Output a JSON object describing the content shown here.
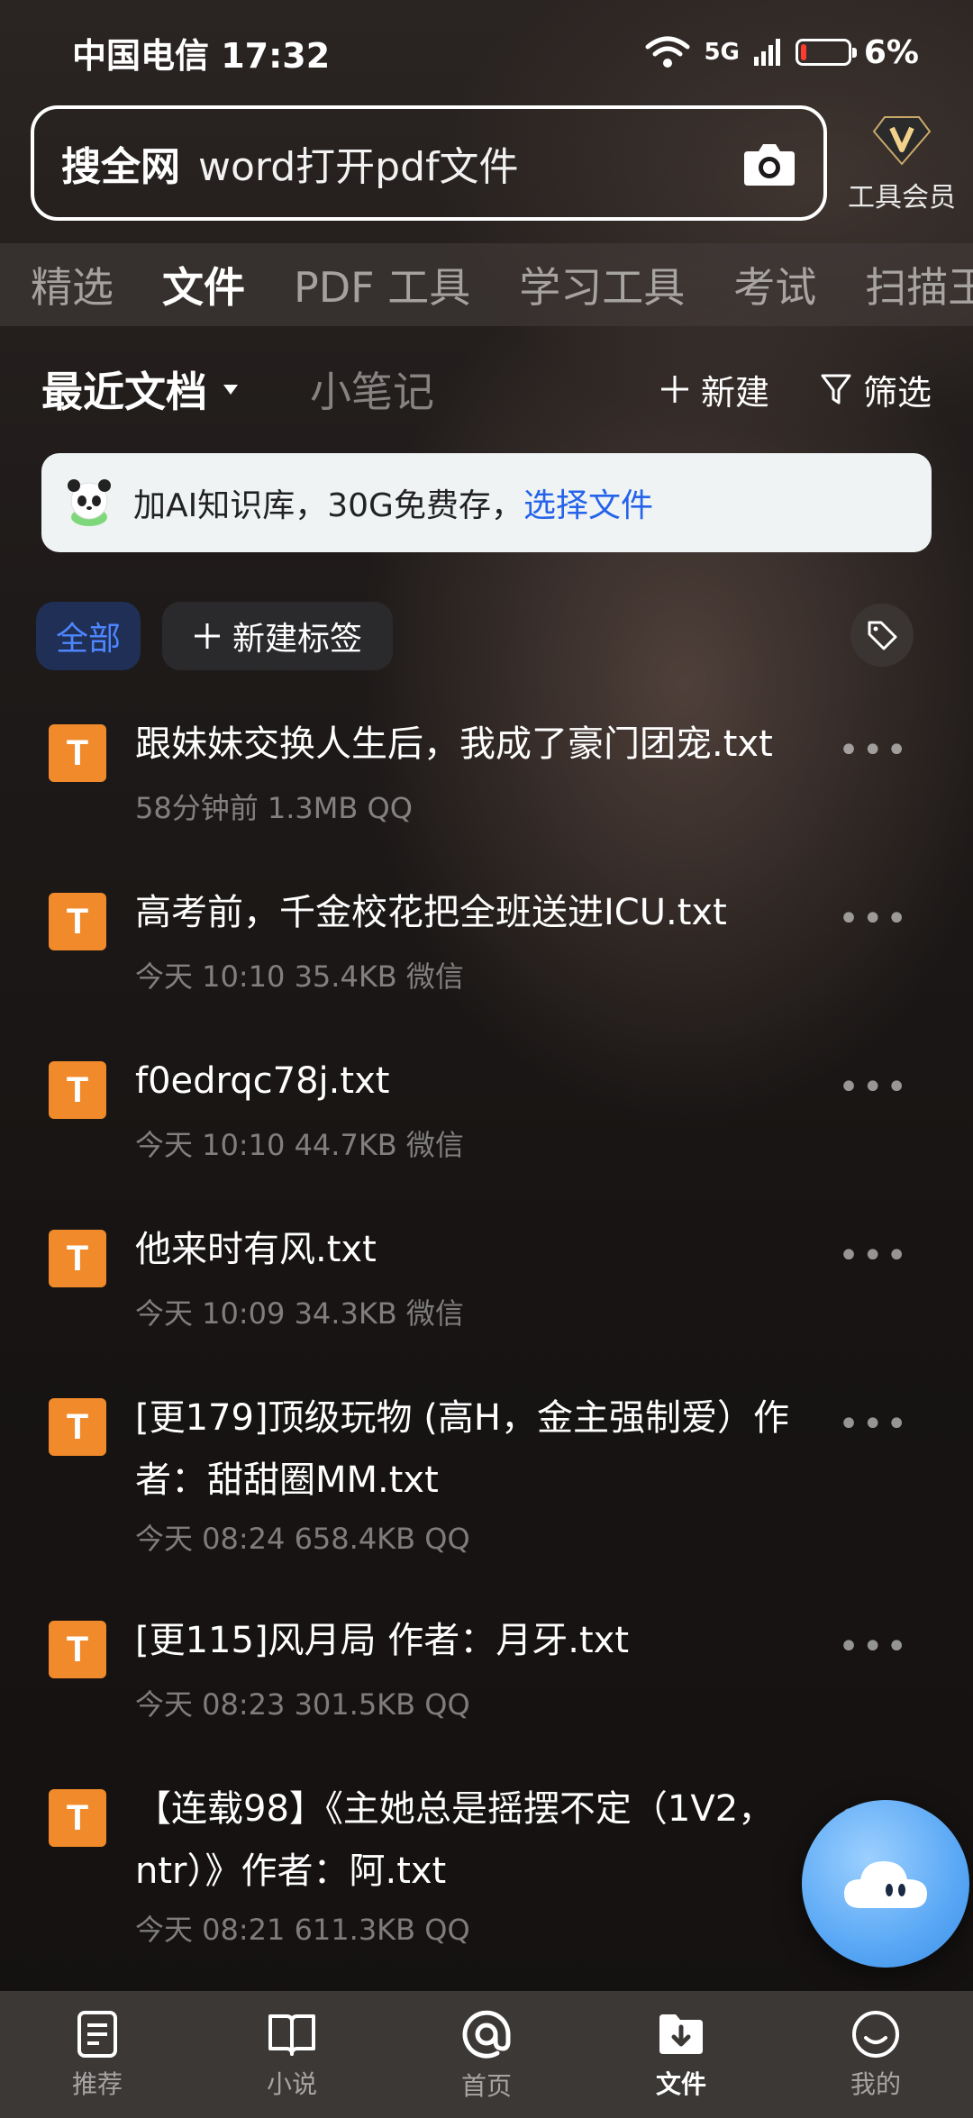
{
  "status": {
    "carrier_time": "中国电信 17:32",
    "network": "5G",
    "battery": "6%"
  },
  "search": {
    "brand": "搜全网",
    "query": "word打开pdf文件"
  },
  "vip": {
    "label": "工具会员",
    "badge": "V"
  },
  "tabs": [
    {
      "label": "精选",
      "active": false
    },
    {
      "label": "文件",
      "active": true
    },
    {
      "label": "PDF 工具",
      "active": false
    },
    {
      "label": "学习工具",
      "active": false
    },
    {
      "label": "考试",
      "active": false
    },
    {
      "label": "扫描王",
      "active": false
    }
  ],
  "header": {
    "recent": "最近文档",
    "notes": "小笔记",
    "new": "新建",
    "filter": "筛选"
  },
  "banner": {
    "text": "加AI知识库，30G免费存，",
    "link": "选择文件"
  },
  "chips": {
    "all": "全部",
    "new_tag": "新建标签"
  },
  "files": [
    {
      "name": "跟妹妹交换人生后，我成了豪门团宠.txt",
      "meta": "58分钟前  1.3MB  QQ"
    },
    {
      "name": "高考前，千金校花把全班送进ICU.txt",
      "meta": "今天 10:10  35.4KB  微信"
    },
    {
      "name": "f0edrqc78j.txt",
      "meta": "今天 10:10  44.7KB  微信"
    },
    {
      "name": "他来时有风.txt",
      "meta": "今天 10:09  34.3KB  微信"
    },
    {
      "name": "[更179]顶级玩物 (高H，金主强制爱）作者：甜甜圈MM.txt",
      "meta": "今天 08:24  658.4KB  QQ"
    },
    {
      "name": "[更115]风月局 作者：月牙.txt",
      "meta": "今天 08:23  301.5KB  QQ"
    },
    {
      "name": "【连载98】《主她总是摇摆不定（1V2，ntr）》作者：阿.txt",
      "meta": "今天 08:21  611.3KB  QQ"
    }
  ],
  "file_icon_letter": "T",
  "nav": [
    {
      "label": "推荐",
      "icon": "document-icon"
    },
    {
      "label": "小说",
      "icon": "book-icon"
    },
    {
      "label": "首页",
      "icon": "search-home-icon"
    },
    {
      "label": "文件",
      "icon": "download-folder-icon",
      "active": true
    },
    {
      "label": "我的",
      "icon": "smile-icon"
    }
  ],
  "colors": {
    "accent": "#2f6bff",
    "file_icon": "#f08a2b",
    "link": "#2563eb"
  }
}
